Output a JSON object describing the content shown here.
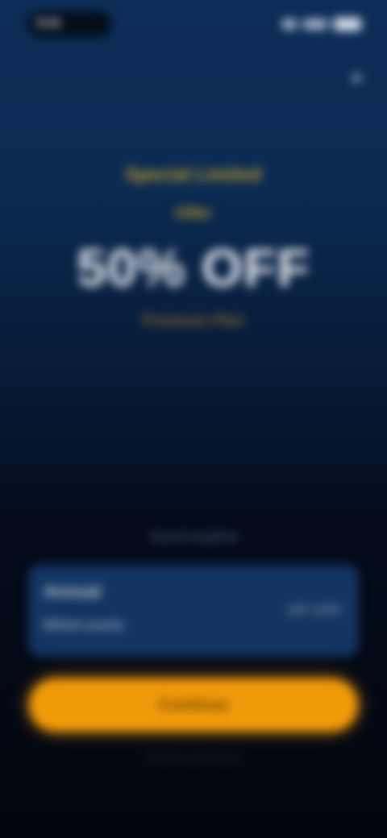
{
  "status_bar": {
    "time": "9:41"
  },
  "header": {
    "close_glyph": "×"
  },
  "hero": {
    "eyebrow": "Special Limited",
    "eyebrow_sub": "Offer",
    "headline": "50% OFF",
    "subhead": "Premium Plan"
  },
  "offer": {
    "caption": "Cancel anytime",
    "plan": {
      "name": "Annual",
      "sub": "Billed yearly",
      "price": "per year"
    }
  },
  "cta": {
    "label": "Continue",
    "note": "Restore purchases"
  },
  "colors": {
    "accent": "#f09a0a",
    "gold": "#c9a227",
    "background_top": "#0c2d57",
    "background_bottom": "#01050c"
  },
  "icons": {
    "close": "close-icon",
    "signal": "signal-icon",
    "wifi": "wifi-icon",
    "battery": "battery-icon"
  }
}
